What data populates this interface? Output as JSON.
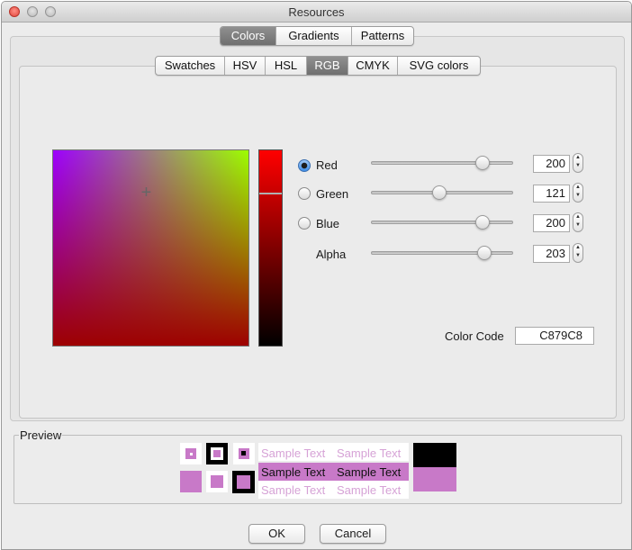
{
  "window": {
    "title": "Resources"
  },
  "top_tabs": [
    "Colors",
    "Gradients",
    "Patterns"
  ],
  "top_tab_selected": "Colors",
  "color_tabs": [
    "Swatches",
    "HSV",
    "HSL",
    "RGB",
    "CMYK",
    "SVG colors"
  ],
  "color_tab_selected": "RGB",
  "channels": [
    {
      "label": "Red",
      "value": "200",
      "level": 0.78,
      "selected": true
    },
    {
      "label": "Green",
      "value": "121",
      "level": 0.47,
      "selected": false
    },
    {
      "label": "Blue",
      "value": "200",
      "level": 0.78,
      "selected": false
    },
    {
      "label": "Alpha",
      "value": "203",
      "level": 0.8,
      "selected": false
    }
  ],
  "color_code": {
    "label": "Color Code",
    "value": "C879C8"
  },
  "preview": {
    "title": "Preview",
    "sample_text": "Sample Text",
    "color": "#c879c8"
  },
  "buttons": {
    "ok": "OK",
    "cancel": "Cancel"
  },
  "icons": {
    "crosshair": "crosshair-icon",
    "stepper": "stepper-arrows-icon"
  }
}
